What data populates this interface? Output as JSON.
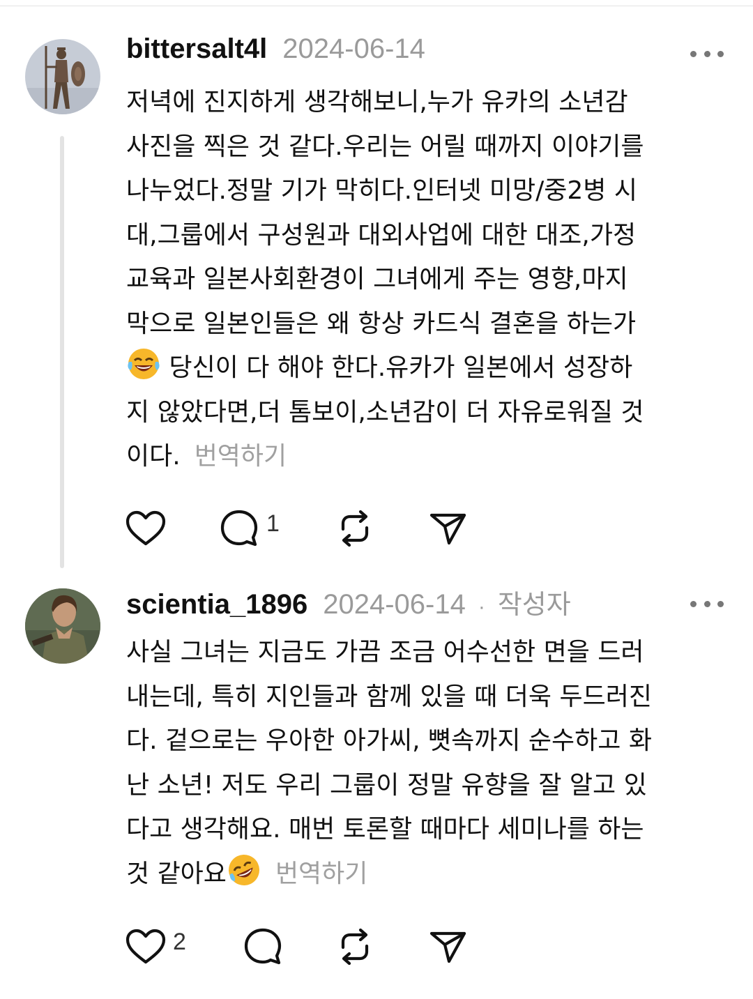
{
  "comments": [
    {
      "username": "bittersalt4l",
      "date": "2024-06-14",
      "author_tag": "",
      "avatar": "statue-avatar",
      "lines": [
        "저녁에 진지하게 생각해보니,누가 유카의 소년감",
        "사진을 찍은 것 같다.우리는 어릴 때까지 이야기를",
        "나누었다.정말 기가 막히다.인터넷 미망/중2병 시",
        "대,그룹에서 구성원과 대외사업에 대한 대조,가정",
        "교육과 일본사회환경이 그녀에게 주는 영향,마지",
        "막으로 일본인들은 왜 항상 카드식 결혼을 하는가",
        " 당신이 다 해야 한다.유카가 일본에서 성장하",
        "지 않았다면,더 톰보이,소년감이 더 자유로워질 것",
        "이다."
      ],
      "translate": "번역하기",
      "emoji": "laughing-tears-emoji",
      "likes": "",
      "replies": "1"
    },
    {
      "username": "scientia_1896",
      "date": "2024-06-14",
      "dot": "·",
      "author_tag": "작성자",
      "avatar": "character-avatar",
      "lines": [
        "사실 그녀는 지금도 가끔 조금 어수선한 면을 드러",
        "내는데, 특히 지인들과 함께 있을 때 더욱 두드러진",
        "다. 겉으로는 우아한 아가씨, 뼛속까지 순수하고 화",
        "난 소년! 저도 우리 그룹이 정말 유향을 잘 알고 있",
        "다고 생각해요. 매번 토론할 때마다 세미나를 하는",
        "것 같아요"
      ],
      "translate": "번역하기",
      "emoji": "rolling-laughing-emoji",
      "likes": "2",
      "replies": ""
    }
  ],
  "colors": {
    "text": "#111111",
    "muted": "#9a9a9a",
    "thread_line": "#e3e3e3",
    "emoji": "#f7b72a"
  }
}
